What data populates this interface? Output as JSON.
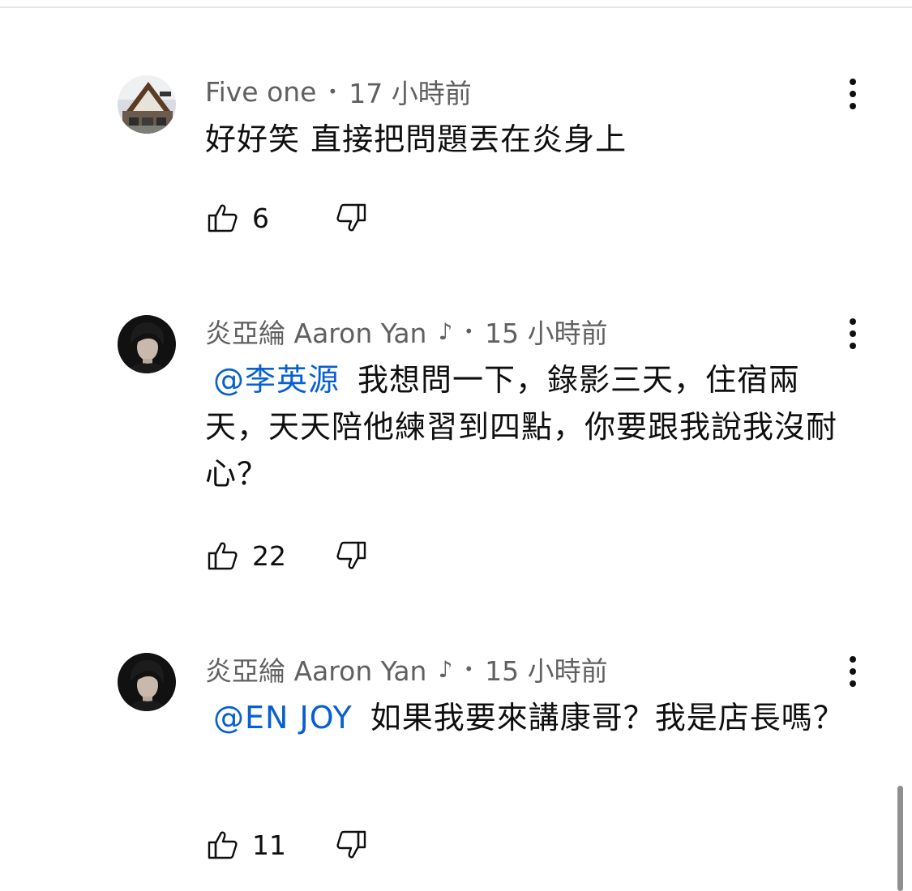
{
  "comments": [
    {
      "author": "Five one",
      "time": "17 小時前",
      "text": "好好笑 直接把問題丟在炎身上",
      "likes": "6",
      "avatar": "building-photo"
    },
    {
      "author": "炎亞綸 Aaron Yan",
      "note_icon": "♪",
      "time": "15 小時前",
      "mention": "@李英源",
      "text": "我想問一下，錄影三天，住宿兩天，天天陪他練習到四點，你要跟我說我沒耐心？",
      "likes": "22",
      "avatar": "person-photo"
    },
    {
      "author": "炎亞綸 Aaron Yan",
      "note_icon": "♪",
      "time": "15 小時前",
      "mention": "@EN JOY",
      "text": "如果我要來講康哥？我是店長嗎？",
      "likes": "11",
      "avatar": "person-photo"
    }
  ],
  "separator": "•",
  "colors": {
    "meta_text": "#606060",
    "body_text": "#0f0f0f",
    "mention": "#065fd4"
  }
}
